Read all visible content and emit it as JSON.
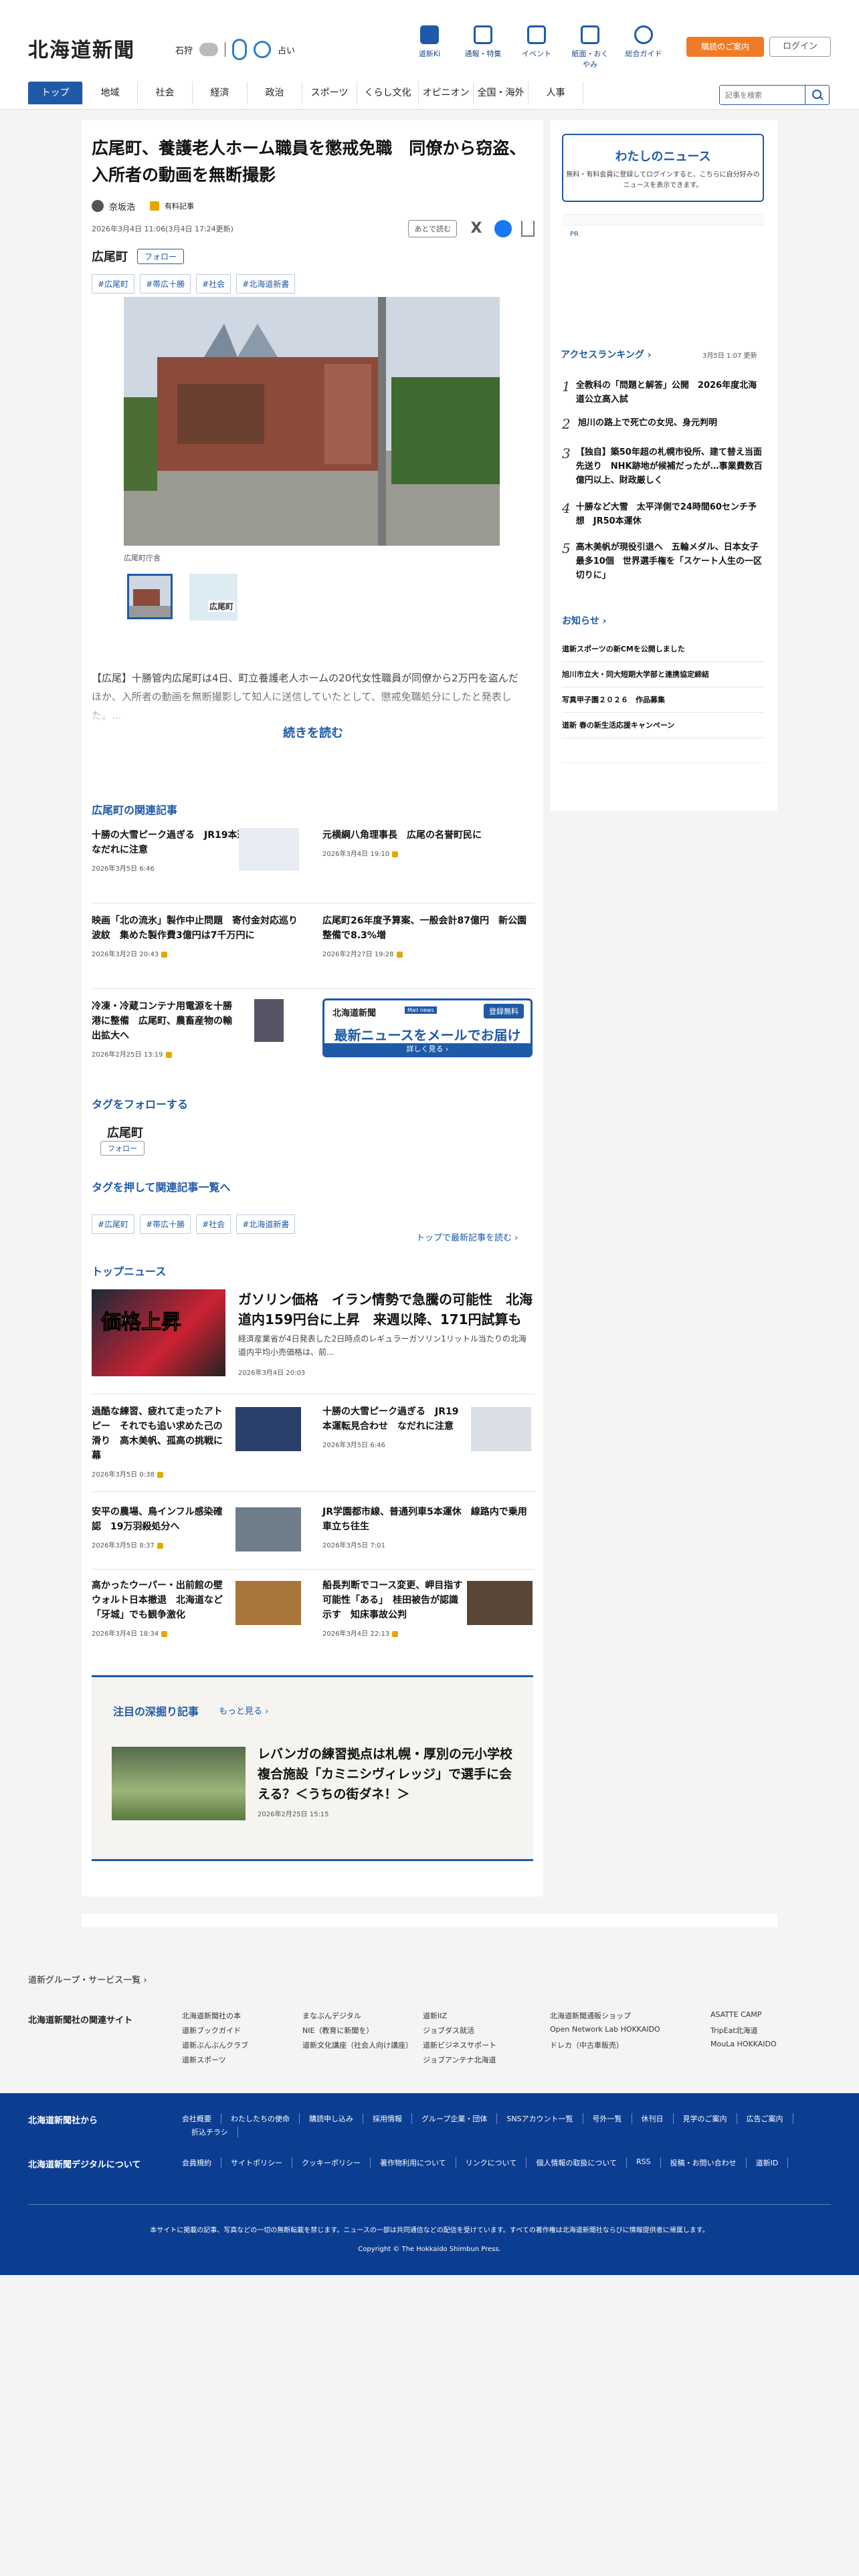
{
  "header": {
    "logo": "北海道新聞",
    "weather_place": "石狩",
    "weather_temp": "",
    "location_label": "占い",
    "quick_links": [
      "道新Ki",
      "通報・特集",
      "イベント",
      "紙面・おくやみ",
      "総合ガイド"
    ],
    "btn_subscribe": "購読のご案内",
    "btn_login": "ログイン",
    "nav": [
      "トップ",
      "地域",
      "社会",
      "経済",
      "政治",
      "スポーツ",
      "くらし文化",
      "オピニオン",
      "全国・海外",
      "人事"
    ],
    "search_placeholder": "記事を検索"
  },
  "article": {
    "title": "広尾町、養護老人ホーム職員を懲戒免職　同僚から窃盗、入所者の動画を無断撮影",
    "author": "奈坂浩",
    "premium": "有料記事",
    "date": "2026年3月4日 11:06(3月4日 17:24更新)",
    "later": "あとで読む",
    "share_x": "X",
    "tag_head": "広尾町",
    "follow": "フォロー",
    "tags": [
      "#広尾町",
      "#帯広十勝",
      "#社会",
      "#北海道新書"
    ],
    "photo_caption": "広尾町庁舎",
    "thumb2_label": "広尾町",
    "lead": "【広尾】十勝管内広尾町は4日、町立養護老人ホームの20代女性職員が同僚から2万円を盗んだほか、入所者の動画を無断撮影して知人に送信していたとして、懲戒免職処分にしたと発表した。...",
    "read_more": "続きを読む"
  },
  "related": {
    "heading": "広尾町の関連記事",
    "items": [
      {
        "title": "十勝の大雪ピーク過ぎる　JR19本運転見合わせ　なだれに注意",
        "date": "2026年3月5日 6:46"
      },
      {
        "title": "元横綱八角理事長　広尾の名誉町民に",
        "date": "2026年3月4日 19:10"
      },
      {
        "title": "映画「北の流氷」製作中止問題　寄付金対応巡り波紋　集めた製作費3億円は7千万円に",
        "date": "2026年3月2日 20:43"
      },
      {
        "title": "広尾町26年度予算案、一般会計87億円　新公園整備で8.3%増",
        "date": "2026年2月27日 19:28"
      },
      {
        "title": "冷凍・冷蔵コンテナ用電源を十勝港に整備　広尾町、農畜産物の輸出拡大へ",
        "date": "2026年2月25日 13:19"
      }
    ],
    "ad": {
      "logo": "北海道新聞",
      "badge": "Mail news",
      "reg": "登録無料",
      "main": "最新ニュースをメールでお届け",
      "sub": "詳しく見る ›"
    }
  },
  "follow_tag": {
    "heading": "タグをフォローする",
    "name": "広尾町",
    "btn": "フォロー"
  },
  "tag_search": {
    "heading": "タグを押して関連記事一覧へ",
    "tags": [
      "#広尾町",
      "#帯広十勝",
      "#社会",
      "#北海道新書"
    ],
    "link": "トップで最新記事を読む ›"
  },
  "top_news": {
    "heading": "トップニュース",
    "feature": {
      "img_text": "価格上昇",
      "title": "ガソリン価格　イラン情勢で急騰の可能性　北海道内159円台に上昇　来週以降、171円試算も",
      "summary": "経済産業省が4日発表した2日時点のレギュラーガソリン1リットル当たりの北海道内平均小売価格は、前...",
      "date": "2026年3月4日 20:03"
    },
    "items": [
      {
        "title": "過酷な練習、疲れて走ったアトピー　それでも追い求めた己の滑り　高木美帆、孤高の挑戦に幕",
        "date": "2026年3月5日 0:38"
      },
      {
        "title": "十勝の大雪ピーク過ぎる　JR19本運転見合わせ　なだれに注意",
        "date": "2026年3月5日 6:46"
      },
      {
        "title": "安平の農場、鳥インフル感染確認　19万羽殺処分へ",
        "date": "2026年3月5日 8:37"
      },
      {
        "title": "JR学園都市線、普通列車5本運休　線路内で乗用車立ち往生",
        "date": "2026年3月5日 7:01"
      },
      {
        "title": "高かったウーパー・出前館の壁　ウォルト日本撤退　北海道など「牙城」でも観争激化",
        "date": "2026年3月4日 18:34"
      },
      {
        "title": "船長判断でコース変更、岬目指す可能性「ある」　桂田被告が認識示す　知床事故公判",
        "date": "2026年3月4日 22:13"
      }
    ]
  },
  "deep": {
    "heading": "注目の深掘り記事",
    "more": "もっと見る ›",
    "title": "レバンガの練習拠点は札幌・厚別の元小学校　複合施設「カミニシヴィレッジ」で選手に会える？＜うちの街ダネ！＞",
    "date": "2026年2月25日 15:15"
  },
  "side": {
    "mynews_title": "わたしのニュース",
    "mynews_text": "無料・有料会員に登録してログインすると、こちらに自分好みのニュースを表示できます。",
    "pr_label": "PR",
    "ranking_title": "アクセスランキング ›",
    "ranking_date": "3月5日 1:07 更新",
    "ranking": [
      {
        "n": "1",
        "title": "全教科の「問題と解答」公開　2026年度北海道公立高入試"
      },
      {
        "n": "2",
        "title": "旭川の路上で死亡の女児、身元判明"
      },
      {
        "n": "3",
        "title": "【独自】築50年超の札幌市役所、建て替え当面先送り　NHK跡地が候補だったが…事業費数百億円以上、財政厳しく"
      },
      {
        "n": "4",
        "title": "十勝など大雪　太平洋側で24時間60センチ予想　JR50本運休"
      },
      {
        "n": "5",
        "title": "高木美帆が現役引退へ　五輪メダル、日本女子最多10個　世界選手権を「スケート人生の一区切りに」"
      }
    ],
    "notice_title": "お知らせ ›",
    "notices": [
      "道新スポーツの新CMを公開しました",
      "旭川市立大・同大短期大学部と連携協定締結",
      "写真甲子園２０２６　作品募集",
      "道新 春の新生活応援キャンペーン"
    ]
  },
  "bottom": {
    "group": "道新グループ・サービス一覧 ›",
    "related_sites_label": "北海道新聞社の関連サイト",
    "related_sites": [
      "北海道新聞社の本",
      "まなぶんデジタル",
      "道新IIZ",
      "北海道新聞通販ショップ",
      "ASATTE CAMP",
      "道新ブックガイド",
      "NIE（教育に新聞を）",
      "ジョブダス就活",
      "Open Network Lab HOKKAIDO",
      "TripEat北海道",
      "道新ぶんぶんクラブ",
      "道新文化講座（社会人向け講座）",
      "道新ビジネスサポート",
      "ドレカ（中古車販売）",
      "MouLa HOKKAIDO",
      "道新スポーツ",
      "",
      "ジョブアンテナ北海道",
      "",
      ""
    ]
  },
  "footer": {
    "from_label": "北海道新聞社から",
    "from_links": [
      "会社概要",
      "わたしたちの使命",
      "購読申し込み",
      "採用情報",
      "グループ企業・団体",
      "SNSアカウント一覧",
      "号外一覧",
      "休刊日",
      "見学のご案内",
      "広告ご案内",
      "折込チラシ"
    ],
    "digital_label": "北海道新聞デジタルについて",
    "digital_links": [
      "会員規約",
      "サイトポリシー",
      "クッキーポリシー",
      "著作物利用について",
      "リンクについて",
      "個人情報の取扱について",
      "RSS",
      "投稿・お問い合わせ",
      "道新ID"
    ],
    "disclaimer": "本サイトに掲載の記事、写真などの一切の無断転載を禁じます。ニュースの一部は共同通信などの配信を受けています。すべての著作権は北海道新聞社ならびに情報提供者に帰属します。",
    "copyright": "Copyright © The Hokkaido Shimbun Press."
  }
}
